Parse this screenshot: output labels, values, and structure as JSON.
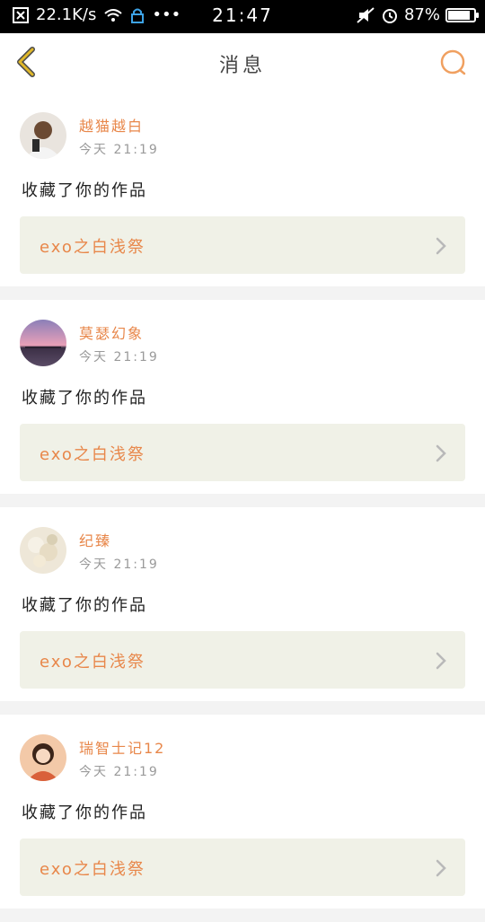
{
  "status_bar": {
    "speed": "22.1K/s",
    "time": "21:47",
    "battery": "87%"
  },
  "header": {
    "title": "消息"
  },
  "messages": [
    {
      "user": "越猫越白",
      "time": "今天 21:19",
      "action": "收藏了你的作品",
      "work": "exo之白浅祭"
    },
    {
      "user": "莫瑟幻象",
      "time": "今天 21:19",
      "action": "收藏了你的作品",
      "work": "exo之白浅祭"
    },
    {
      "user": "纪臻",
      "time": "今天 21:19",
      "action": "收藏了你的作品",
      "work": "exo之白浅祭"
    },
    {
      "user": "瑞智士记12",
      "time": "今天 21:19",
      "action": "收藏了你的作品",
      "work": "exo之白浅祭"
    }
  ],
  "colors": {
    "accent": "#e8874a",
    "back_arrow": "#e0b82a",
    "card_bg": "#f0f1e7"
  },
  "icons": {
    "back": "back-arrow-icon",
    "search": "search-icon",
    "chevron": "chevron-right-icon"
  }
}
